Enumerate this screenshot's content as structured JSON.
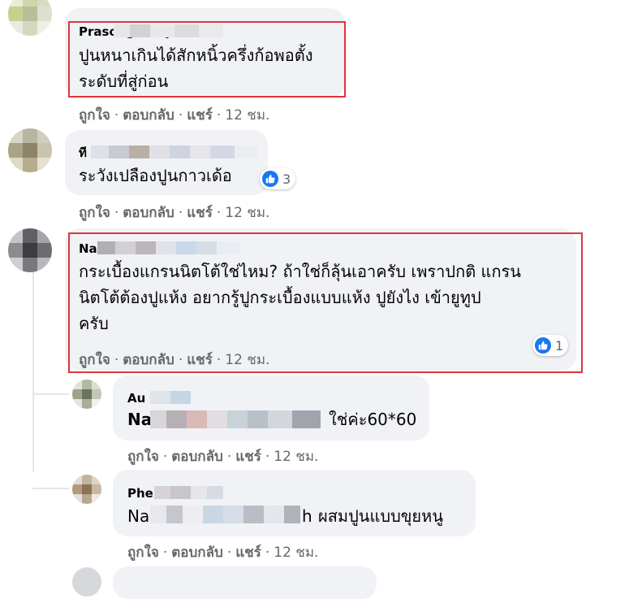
{
  "comments": [
    {
      "author": "Prasong Chayanith",
      "lines": [
        "ปูนหนาเกินได้สักหนิ้วครึ่งก้อพอตั้ง",
        "ระดับที่สู่ก่อน"
      ],
      "like": "ถูกใจ",
      "reply": "ตอบกลับ",
      "share": "แชร์",
      "time": "12 ชม."
    },
    {
      "author": "ที",
      "lines": [
        "ระวังเปลืองปูนกาวเด้อ"
      ],
      "reactions": "3",
      "like": "ถูกใจ",
      "reply": "ตอบกลับ",
      "share": "แชร์",
      "time": "12 ชม."
    },
    {
      "author": "Na",
      "lines": [
        "กระเบื้องแกรนนิตโต้ใช่ไหม? ถ้าใช่ก็ลุ้นเอาครับ เพราปกติ แกรน",
        "นิตโต้ต้องปูแห้ง อยากรู้ปูกระเบื้องแบบแห้ง ปูยังไง เข้ายูทูป",
        "ครับ"
      ],
      "reactions": "1",
      "like": "ถูกใจ",
      "reply": "ตอบกลับ",
      "share": "แชร์",
      "time": "12 ชม."
    }
  ],
  "replies": [
    {
      "author": "Au",
      "mention": "Na",
      "text": "ใช่ค่ะ60*60",
      "like": "ถูกใจ",
      "reply": "ตอบกลับ",
      "share": "แชร์",
      "time": "12 ชม."
    },
    {
      "author": "Phe",
      "mention": "Na",
      "mention_tail": "h",
      "text": "ผสมปูนแบบขุยหนู",
      "like": "ถูกใจ",
      "reply": "ตอบกลับ",
      "share": "แชร์",
      "time": "12 ชม."
    }
  ],
  "colors": {
    "bubble": "#f0f2f5",
    "meta": "#65676b",
    "like_blue": "#1877f2",
    "highlight_red": "#e0343c"
  },
  "icons": {
    "reaction": "like-thumb-icon"
  }
}
